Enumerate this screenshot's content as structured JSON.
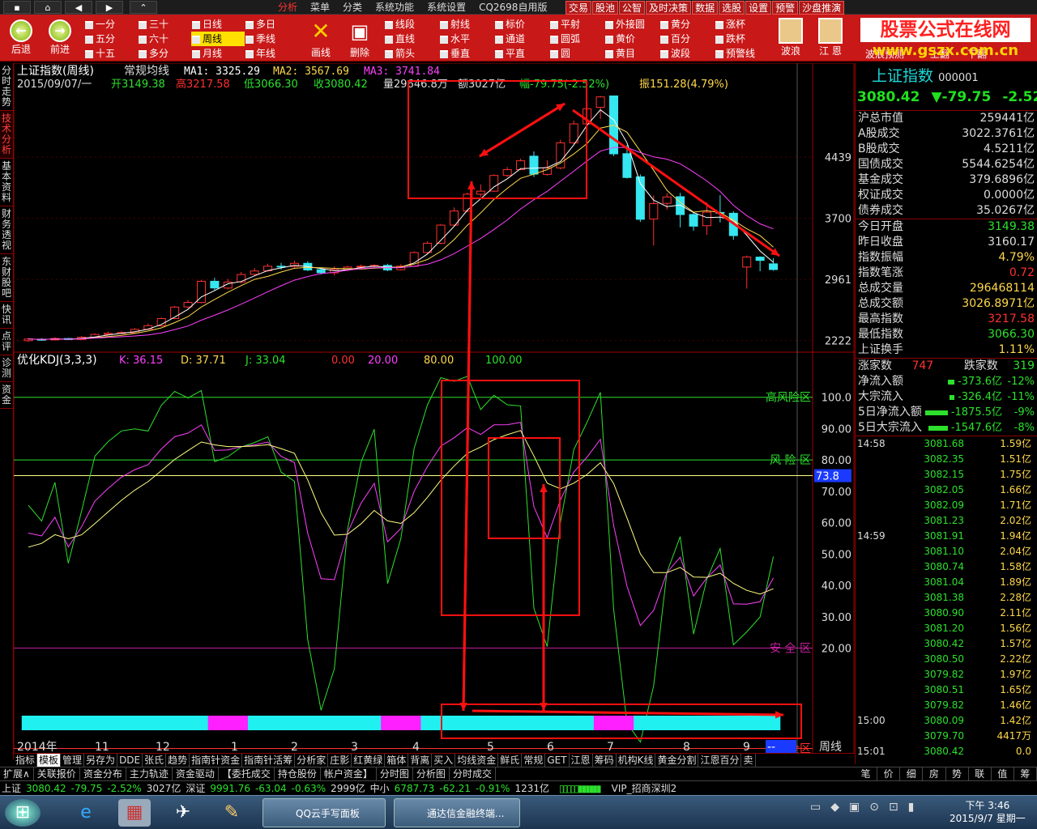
{
  "topbar": {
    "menu": [
      "分析",
      "菜单",
      "分类",
      "系统功能",
      "系统设置",
      "CQ2698自用版"
    ],
    "right_menu": [
      "交易",
      "股池",
      "公智",
      "及时决策",
      "数据",
      "选股",
      "设置",
      "预警",
      "沙盘推演"
    ]
  },
  "toolbar": {
    "back": "后退",
    "forward": "前进",
    "periods": [
      "一分",
      "五分",
      "十五",
      "三十",
      "六十",
      "多分",
      "日线",
      "周线",
      "月线",
      "多日",
      "季线",
      "年线"
    ],
    "active_period": "周线",
    "draw_line": "画线",
    "delete": "删除",
    "tools": [
      "线段",
      "直线",
      "箭头",
      "射线",
      "水平",
      "垂直",
      "标价",
      "通道",
      "平直",
      "平射",
      "圆弧",
      "圆",
      "外接圆",
      "黄价",
      "黄目",
      "黄分",
      "百分",
      "波段",
      "涨杯",
      "跌杯",
      "预警线"
    ],
    "wave": "波浪",
    "jiang_en": "江 恩",
    "wave_predict": "波浪预测",
    "page_up": "上翻",
    "page_down": "下翻"
  },
  "logo": {
    "line1": "股票公式在线网",
    "line2": "www.gszx.com.cn"
  },
  "side_tabs": [
    "分时走势",
    "技术分析",
    "基本资料",
    "财务透视",
    "东财股吧",
    "快讯",
    "点评",
    "诊测",
    "资金"
  ],
  "main_header": {
    "title": "上证指数(周线)",
    "ma_label": "常规均线",
    "ma1": "MA1: 3325.29",
    "ma2": "MA2: 3567.69",
    "ma3": "MA3: 3741.84",
    "date": "2015/09/07/一",
    "open": "开3149.38",
    "high": "高3217.58",
    "low": "低3066.30",
    "close": "收3080.42",
    "volume": "量29646.8万",
    "amount": "额3027亿",
    "change": "幅-79.75(-2.52%)",
    "amplitude": "振151.28(4.79%)"
  },
  "kdj_header": {
    "label": "优化KDJ(3,3,3)",
    "k": "K: 36.15",
    "d": "D: 37.71",
    "j": "J: 33.04",
    "v0": "0.00",
    "v20": "20.00",
    "v80": "80.00",
    "v100": "100.00"
  },
  "zones": {
    "high_risk": "高风险区",
    "risk": "风 险 区",
    "safe": "安 全 区",
    "high_safe": "高安全区"
  },
  "axis_right_price": [
    "4439",
    "3700",
    "2961",
    "2222"
  ],
  "axis_right_kdj": [
    "100.0",
    "90.00",
    "80.00",
    "70.00",
    "60.00",
    "50.00",
    "40.00",
    "30.00",
    "20.00"
  ],
  "kdj_current": "73.8",
  "x_axis": [
    "2014年",
    "11",
    "12",
    "1",
    "2",
    "3",
    "4",
    "5",
    "6",
    "7",
    "8",
    "9",
    "--",
    "周线"
  ],
  "chart_data": {
    "type": "candlestick",
    "title": "上证指数(周线)",
    "candles": [
      {
        "o": 2220,
        "c": 2240,
        "h": 2255,
        "l": 2205
      },
      {
        "o": 2236,
        "c": 2232,
        "h": 2250,
        "l": 2220
      },
      {
        "o": 2230,
        "c": 2247,
        "h": 2262,
        "l": 2222
      },
      {
        "o": 2246,
        "c": 2234,
        "h": 2255,
        "l": 2226
      },
      {
        "o": 2235,
        "c": 2262,
        "h": 2278,
        "l": 2230
      },
      {
        "o": 2260,
        "c": 2296,
        "h": 2310,
        "l": 2252
      },
      {
        "o": 2296,
        "c": 2309,
        "h": 2330,
        "l": 2290
      },
      {
        "o": 2306,
        "c": 2319,
        "h": 2334,
        "l": 2300
      },
      {
        "o": 2315,
        "c": 2357,
        "h": 2372,
        "l": 2310
      },
      {
        "o": 2358,
        "c": 2402,
        "h": 2425,
        "l": 2352
      },
      {
        "o": 2400,
        "c": 2488,
        "h": 2500,
        "l": 2392
      },
      {
        "o": 2488,
        "c": 2626,
        "h": 2640,
        "l": 2480
      },
      {
        "o": 2628,
        "c": 2683,
        "h": 2712,
        "l": 2610
      },
      {
        "o": 2682,
        "c": 2938,
        "h": 2955,
        "l": 2670
      },
      {
        "o": 2938,
        "c": 2857,
        "h": 2980,
        "l": 2832
      },
      {
        "o": 2856,
        "c": 2929,
        "h": 2965,
        "l": 2840
      },
      {
        "o": 2930,
        "c": 3020,
        "h": 3050,
        "l": 2910
      },
      {
        "o": 3022,
        "c": 3062,
        "h": 3098,
        "l": 3010
      },
      {
        "o": 3065,
        "c": 3120,
        "h": 3150,
        "l": 3055
      },
      {
        "o": 3120,
        "c": 3118,
        "h": 3160,
        "l": 3080
      },
      {
        "o": 3118,
        "c": 3155,
        "h": 3188,
        "l": 3100
      },
      {
        "o": 3155,
        "c": 3075,
        "h": 3180,
        "l": 3060
      },
      {
        "o": 3078,
        "c": 3042,
        "h": 3100,
        "l": 3020
      },
      {
        "o": 3040,
        "c": 3080,
        "h": 3118,
        "l": 3010
      },
      {
        "o": 3080,
        "c": 3110,
        "h": 3125,
        "l": 3060
      },
      {
        "o": 3112,
        "c": 3120,
        "h": 3140,
        "l": 3095
      },
      {
        "o": 3120,
        "c": 3130,
        "h": 3142,
        "l": 3105
      },
      {
        "o": 3130,
        "c": 3075,
        "h": 3150,
        "l": 3060
      },
      {
        "o": 3078,
        "c": 3120,
        "h": 3145,
        "l": 3070
      },
      {
        "o": 3120,
        "c": 3285,
        "h": 3300,
        "l": 3110
      },
      {
        "o": 3285,
        "c": 3398,
        "h": 3420,
        "l": 3270
      },
      {
        "o": 3398,
        "c": 3617,
        "h": 3630,
        "l": 3385
      },
      {
        "o": 3617,
        "c": 3787,
        "h": 3830,
        "l": 3600
      },
      {
        "o": 3787,
        "c": 3990,
        "h": 4010,
        "l": 3770
      },
      {
        "o": 3990,
        "c": 4027,
        "h": 4110,
        "l": 3960
      },
      {
        "o": 4027,
        "c": 4217,
        "h": 4229,
        "l": 4018
      },
      {
        "o": 4217,
        "c": 4287,
        "h": 4318,
        "l": 4198
      },
      {
        "o": 4287,
        "c": 4394,
        "h": 4420,
        "l": 4280
      },
      {
        "o": 4450,
        "c": 4233,
        "h": 4508,
        "l": 4198
      },
      {
        "o": 4230,
        "c": 4308,
        "h": 4400,
        "l": 4214
      },
      {
        "o": 4308,
        "c": 4611,
        "h": 4650,
        "l": 4290
      },
      {
        "o": 4611,
        "c": 4840,
        "h": 4880,
        "l": 4594
      },
      {
        "o": 4840,
        "c": 5023,
        "h": 5100,
        "l": 4800
      },
      {
        "o": 5040,
        "c": 5166,
        "h": 5178,
        "l": 4900
      },
      {
        "o": 5178,
        "c": 4478,
        "h": 5178,
        "l": 4450
      },
      {
        "o": 4480,
        "c": 4192,
        "h": 4585,
        "l": 4180
      },
      {
        "o": 4200,
        "c": 3687,
        "h": 4230,
        "l": 3656
      },
      {
        "o": 3690,
        "c": 3877,
        "h": 3975,
        "l": 3370
      },
      {
        "o": 3880,
        "c": 3957,
        "h": 4001,
        "l": 3804
      },
      {
        "o": 3960,
        "c": 3744,
        "h": 4006,
        "l": 3590
      },
      {
        "o": 3745,
        "c": 3604,
        "h": 3780,
        "l": 3550
      },
      {
        "o": 3610,
        "c": 3773,
        "h": 3890,
        "l": 3500
      },
      {
        "o": 3770,
        "c": 3763,
        "h": 3980,
        "l": 3650
      },
      {
        "o": 3760,
        "c": 3490,
        "h": 3785,
        "l": 3440
      },
      {
        "o": 3110,
        "c": 3232,
        "h": 3250,
        "l": 2850
      },
      {
        "o": 3230,
        "c": 3190,
        "h": 3240,
        "l": 3060
      },
      {
        "o": 3149,
        "c": 3080,
        "h": 3217,
        "l": 3066
      }
    ],
    "ylim": [
      2150,
      5300
    ],
    "kdj": {
      "ylim": [
        0,
        110
      ],
      "levels": [
        100,
        80,
        75,
        20,
        0
      ]
    }
  },
  "info": {
    "name": "上证指数",
    "code": "000001",
    "price": "3080.42",
    "change": "▼-79.75",
    "pct": "-2.52%",
    "rows1": [
      {
        "k": "沪总市值",
        "v": "259441亿",
        "c": "#ddd"
      },
      {
        "k": "A股成交",
        "v": "3022.3761亿",
        "c": "#ddd"
      },
      {
        "k": "B股成交",
        "v": "4.5211亿",
        "c": "#ddd"
      },
      {
        "k": "国债成交",
        "v": "5544.6254亿",
        "c": "#ddd"
      },
      {
        "k": "基金成交",
        "v": "379.6896亿",
        "c": "#ddd"
      },
      {
        "k": "权证成交",
        "v": "0.0000亿",
        "c": "#ddd"
      },
      {
        "k": "债券成交",
        "v": "35.0267亿",
        "c": "#ddd"
      }
    ],
    "rows2": [
      {
        "k": "今日开盘",
        "v": "3149.38",
        "c": "#2de02d"
      },
      {
        "k": "昨日收盘",
        "v": "3160.17",
        "c": "#ddd"
      },
      {
        "k": "指数振幅",
        "v": "4.79%",
        "c": "#ffd84a"
      },
      {
        "k": "指数笔涨",
        "v": "0.72",
        "c": "#ff3030"
      },
      {
        "k": "总成交量",
        "v": "296468114",
        "c": "#ffd84a"
      },
      {
        "k": "总成交额",
        "v": "3026.8971亿",
        "c": "#ffd84a"
      },
      {
        "k": "最高指数",
        "v": "3217.58",
        "c": "#ff3030"
      },
      {
        "k": "最低指数",
        "v": "3066.30",
        "c": "#2de02d"
      },
      {
        "k": "上证换手",
        "v": "1.11%",
        "c": "#ffd84a"
      }
    ],
    "up_label": "涨家数",
    "up": "747",
    "down_label": "跌家数",
    "down": "319",
    "flows": [
      {
        "k": "净流入额",
        "v": "-373.6亿",
        "p": "-12%",
        "w": 8
      },
      {
        "k": "大宗流入",
        "v": "-326.4亿",
        "p": "-11%",
        "w": 6
      },
      {
        "k": "5日净流入额",
        "v": "-1875.5亿",
        "p": "-9%",
        "w": 28
      },
      {
        "k": "5日大宗流入",
        "v": "-1547.6亿",
        "p": "-8%",
        "w": 24
      }
    ],
    "ticks": [
      {
        "t": "14:58",
        "p": "3081.68",
        "v": "1.59亿"
      },
      {
        "t": "",
        "p": "3082.35",
        "v": "1.51亿"
      },
      {
        "t": "",
        "p": "3082.15",
        "v": "1.75亿"
      },
      {
        "t": "",
        "p": "3082.05",
        "v": "1.66亿"
      },
      {
        "t": "",
        "p": "3082.09",
        "v": "1.71亿"
      },
      {
        "t": "",
        "p": "3081.23",
        "v": "2.02亿"
      },
      {
        "t": "14:59",
        "p": "3081.91",
        "v": "1.94亿"
      },
      {
        "t": "",
        "p": "3081.10",
        "v": "2.04亿"
      },
      {
        "t": "",
        "p": "3080.74",
        "v": "1.58亿"
      },
      {
        "t": "",
        "p": "3081.04",
        "v": "1.89亿"
      },
      {
        "t": "",
        "p": "3081.38",
        "v": "2.28亿"
      },
      {
        "t": "",
        "p": "3080.90",
        "v": "2.11亿"
      },
      {
        "t": "",
        "p": "3081.20",
        "v": "1.56亿"
      },
      {
        "t": "",
        "p": "3080.42",
        "v": "1.57亿"
      },
      {
        "t": "",
        "p": "3080.50",
        "v": "2.22亿"
      },
      {
        "t": "",
        "p": "3079.82",
        "v": "1.97亿"
      },
      {
        "t": "",
        "p": "3080.51",
        "v": "1.65亿"
      },
      {
        "t": "",
        "p": "3079.82",
        "v": "1.46亿"
      },
      {
        "t": "15:00",
        "p": "3080.09",
        "v": "1.42亿"
      },
      {
        "t": "",
        "p": "3079.70",
        "v": "4417万"
      },
      {
        "t": "15:01",
        "p": "3080.42",
        "v": "0.0"
      }
    ]
  },
  "bottom_tabs": [
    "指标",
    "模板",
    "管理",
    "另存为",
    "DDE",
    "张氏",
    "趋势",
    "指南针资金",
    "指南针活筹",
    "分析家",
    "庄影",
    "红黄绿",
    "箱体",
    "背离",
    "买入",
    "均线资金",
    "鲜氏",
    "常规",
    "GET",
    "江恩",
    "筹码",
    "机构K线",
    "黄金分割",
    "江恩百分",
    "卖"
  ],
  "bottom_tabs_active": "模板",
  "bottom_tabs2": [
    "扩展∧",
    "关联报价",
    "资金分布",
    "主力轨迹",
    "资金驱动",
    "【委托成交",
    "持仓股份",
    "帐户资金】",
    "分时图",
    "分析图",
    "分时成交"
  ],
  "right_tabs": [
    "笔",
    "价",
    "细",
    "房",
    "势",
    "联",
    "值",
    "筹"
  ],
  "statusbar": {
    "sh_label": "上证",
    "sh_price": "3080.42",
    "sh_chg": "-79.75",
    "sh_pct": "-2.52%",
    "sh_amt": "3027亿",
    "sz_label": "深证",
    "sz_price": "9991.76",
    "sz_chg": "-63.04",
    "sz_pct": "-0.63%",
    "sz_amt": "2999亿",
    "zx_label": "中小",
    "zx_price": "6787.73",
    "zx_chg": "-62.21",
    "zx_pct": "-0.91%",
    "zx_amt": "1231亿",
    "vip": "VIP_招商深圳2"
  },
  "taskbar": {
    "task1": "QQ云手写面板",
    "task2": "通达信金融终端...",
    "time": "下午 3:46",
    "date": "2015/9/7 星期一"
  }
}
